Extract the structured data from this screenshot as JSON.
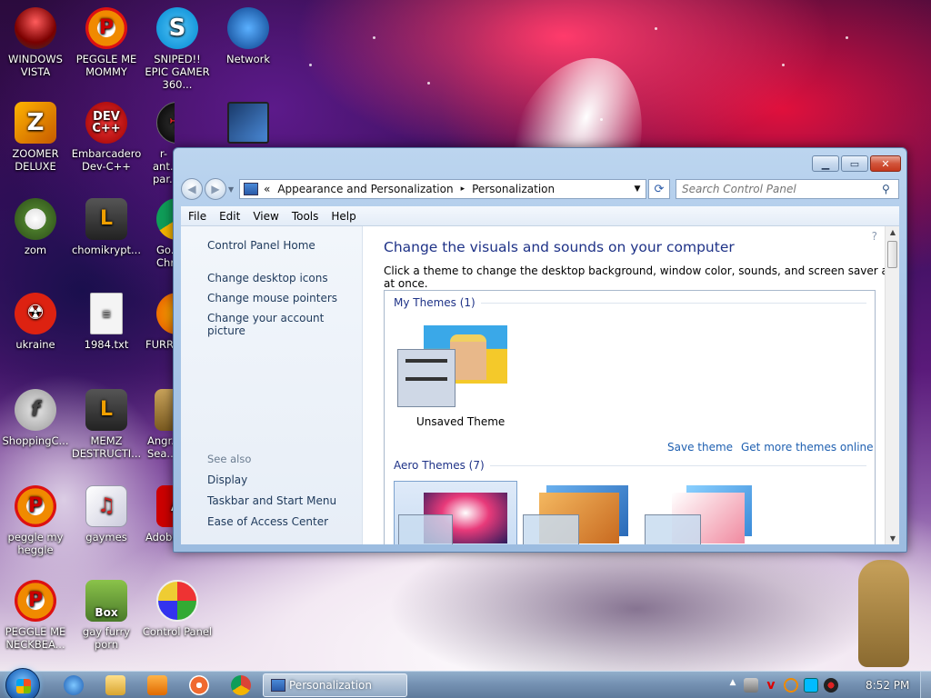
{
  "desktop": {
    "icons": [
      {
        "label": "WINDOWS VISTA",
        "icon": "vista-icon"
      },
      {
        "label": "PEGGLE ME MOMMY",
        "icon": "peggle-icon"
      },
      {
        "label": "SNIPED!! EPIC GAMER 360...",
        "icon": "skype-icon"
      },
      {
        "label": "Network",
        "icon": "network-icon"
      },
      {
        "label": "ZOOMER DELUXE",
        "icon": "zoomer-icon"
      },
      {
        "label": "Embarcadero Dev-C++",
        "icon": "devcpp-icon"
      },
      {
        "label": "r-ant... par...",
        "icon": "r-ant-icon"
      },
      {
        "label": "zom",
        "icon": "zom-icon"
      },
      {
        "label": "chomikrypt...",
        "icon": "chomikrypt-icon"
      },
      {
        "label": "Go... Chr...",
        "icon": "chrome-icon"
      },
      {
        "label": "ukraine",
        "icon": "radiation-icon"
      },
      {
        "label": "1984.txt",
        "icon": "text-file-icon"
      },
      {
        "label": "FURR...",
        "icon": "firefox-icon"
      },
      {
        "label": "ShoppingC...",
        "icon": "flash-icon"
      },
      {
        "label": "MEMZ DESTRUCTI...",
        "icon": "memz-icon"
      },
      {
        "label": "Angr... Sea...",
        "icon": "angry-birds-icon"
      },
      {
        "label": "peggle my heggle",
        "icon": "peggle-icon"
      },
      {
        "label": "gaymes",
        "icon": "gaymes-icon"
      },
      {
        "label": "Adobe...",
        "icon": "adobe-icon"
      },
      {
        "label": "PEGGLE ME NECKBEA...",
        "icon": "peggle-icon"
      },
      {
        "label": "gay furry porn",
        "icon": "box-beaver-icon"
      },
      {
        "label": "Control Panel",
        "icon": "control-panel-icon"
      }
    ]
  },
  "window": {
    "address": {
      "prefix": "«",
      "crumb1": "Appearance and Personalization",
      "separator": "▸",
      "crumb2": "Personalization"
    },
    "search_placeholder": "Search Control Panel",
    "menu": [
      "File",
      "Edit",
      "View",
      "Tools",
      "Help"
    ],
    "left_pane": {
      "home": "Control Panel Home",
      "links": [
        "Change desktop icons",
        "Change mouse pointers",
        "Change your account picture"
      ],
      "see_also_header": "See also",
      "see_also": [
        "Display",
        "Taskbar and Start Menu",
        "Ease of Access Center"
      ]
    },
    "main": {
      "title": "Change the visuals and sounds on your computer",
      "description": "Click a theme to change the desktop background, window color, sounds, and screen saver all at once.",
      "my_themes_header": "My Themes (1)",
      "unsaved_theme": "Unsaved Theme",
      "save_theme": "Save theme",
      "get_more": "Get more themes online",
      "aero_header": "Aero Themes (7)"
    }
  },
  "taskbar": {
    "task_label": "Personalization",
    "clock": "8:52 PM"
  }
}
